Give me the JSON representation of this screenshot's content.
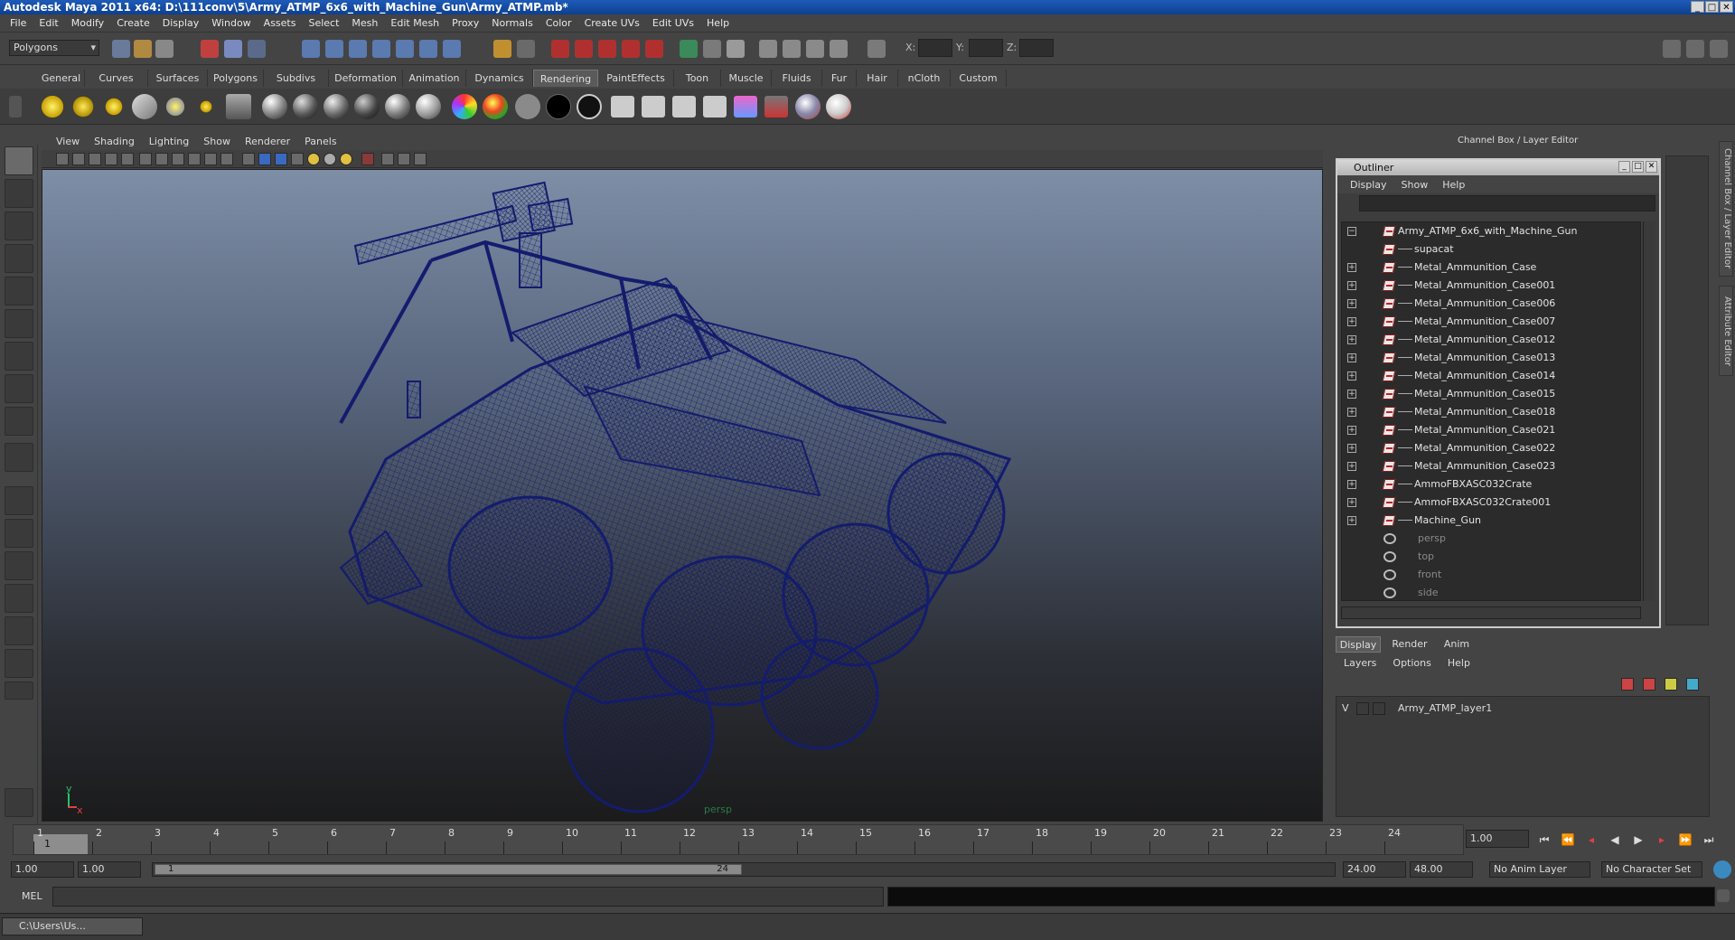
{
  "titlebar": {
    "title": "Autodesk Maya 2011 x64: D:\\111conv\\5\\Army_ATMP_6x6_with_Machine_Gun\\Army_ATMP.mb*"
  },
  "menu": [
    "File",
    "Edit",
    "Modify",
    "Create",
    "Display",
    "Window",
    "Assets",
    "Select",
    "Mesh",
    "Edit Mesh",
    "Proxy",
    "Normals",
    "Color",
    "Create UVs",
    "Edit UVs",
    "Help"
  ],
  "statusline": {
    "mode": "Polygons",
    "x_label": "X:",
    "y_label": "Y:",
    "z_label": "Z:"
  },
  "shelf_tabs": [
    "General",
    "Curves",
    "Surfaces",
    "Polygons",
    "Subdivs",
    "Deformation",
    "Animation",
    "Dynamics",
    "Rendering",
    "PaintEffects",
    "Toon",
    "Muscle",
    "Fluids",
    "Fur",
    "Hair",
    "nCloth",
    "Custom"
  ],
  "shelf_active": "Rendering",
  "viewport": {
    "menu": [
      "View",
      "Shading",
      "Lighting",
      "Show",
      "Renderer",
      "Panels"
    ],
    "camera_label": "persp",
    "axis_y": "y",
    "axis_x": "x",
    "wire_color": "#141c6e"
  },
  "channel_box": {
    "title": "Channel Box / Layer Editor"
  },
  "outliner": {
    "title": "Outliner",
    "menu": [
      "Display",
      "Show",
      "Help"
    ],
    "root": "Army_ATMP_6x6_with_Machine_Gun",
    "children": [
      "supacat",
      "Metal_Ammunition_Case",
      "Metal_Ammunition_Case001",
      "Metal_Ammunition_Case006",
      "Metal_Ammunition_Case007",
      "Metal_Ammunition_Case012",
      "Metal_Ammunition_Case013",
      "Metal_Ammunition_Case014",
      "Metal_Ammunition_Case015",
      "Metal_Ammunition_Case018",
      "Metal_Ammunition_Case021",
      "Metal_Ammunition_Case022",
      "Metal_Ammunition_Case023",
      "AmmoFBXASC032Crate",
      "AmmoFBXASC032Crate001",
      "Machine_Gun"
    ],
    "cameras": [
      "persp",
      "top",
      "front",
      "side"
    ]
  },
  "layer_editor": {
    "tabs": [
      "Display",
      "Render",
      "Anim"
    ],
    "active_tab": "Display",
    "menu": [
      "Layers",
      "Options",
      "Help"
    ],
    "layer_visible": "V",
    "layer_name": "Army_ATMP_layer1"
  },
  "timeline": {
    "ticks": [
      "1",
      "2",
      "3",
      "4",
      "5",
      "6",
      "7",
      "8",
      "9",
      "10",
      "11",
      "12",
      "13",
      "14",
      "15",
      "16",
      "17",
      "18",
      "19",
      "20",
      "21",
      "22",
      "23",
      "24"
    ],
    "current_frame_marker": "1",
    "current_time": "1.00"
  },
  "range": {
    "start": "1.00",
    "anim_start": "1.00",
    "slider_start": "1",
    "slider_end": "24",
    "anim_end": "24.00",
    "end": "48.00",
    "anim_layer": "No Anim Layer",
    "char_set": "No Character Set"
  },
  "cmdline": {
    "label": "MEL"
  },
  "taskbar": {
    "item": "C:\\Users\\Us..."
  },
  "side_tabs": [
    "Channel Box / Layer Editor",
    "Attribute Editor"
  ]
}
